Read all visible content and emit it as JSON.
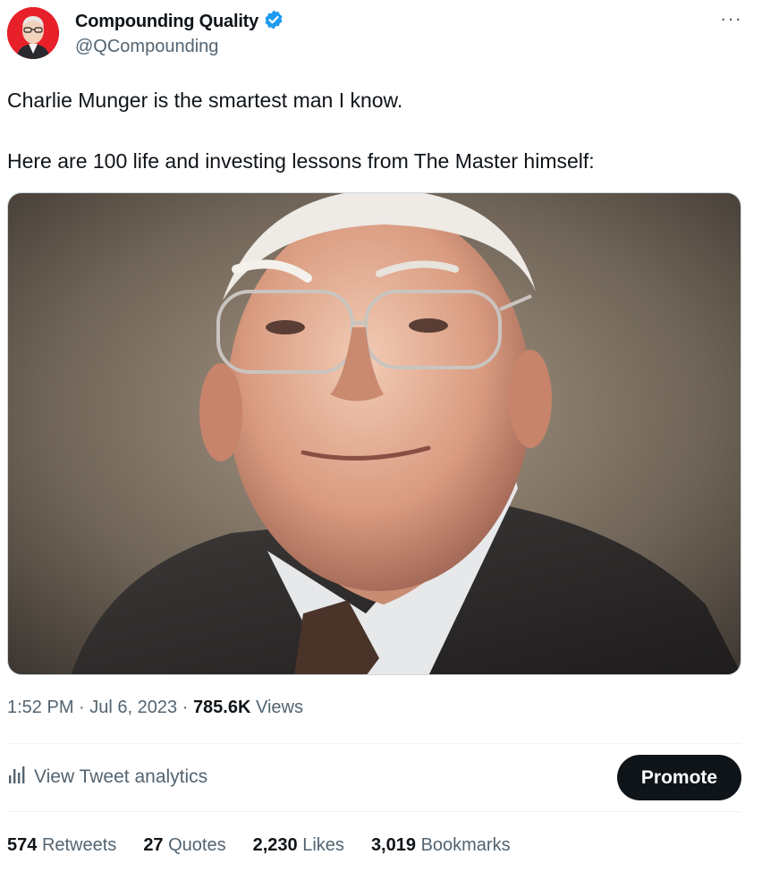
{
  "author": {
    "display_name": "Compounding Quality",
    "handle": "@QCompounding",
    "verified_icon": "verified-badge-icon",
    "avatar_color": "#e8202a"
  },
  "tweet": {
    "lines": [
      "Charlie Munger is the smartest man I know.",
      "Here are 100 life and investing lessons from The Master himself:"
    ],
    "time": "1:52 PM",
    "date": "Jul 6, 2023",
    "views_count": "785.6K",
    "views_label": "Views",
    "separator": "·"
  },
  "actions": {
    "analytics_label": "View Tweet analytics",
    "analytics_icon": "bar-chart-icon",
    "promote_label": "Promote",
    "more_icon": "more-horizontal-icon"
  },
  "stats": [
    {
      "count": "574",
      "label": "Retweets"
    },
    {
      "count": "27",
      "label": "Quotes"
    },
    {
      "count": "2,230",
      "label": "Likes"
    },
    {
      "count": "3,019",
      "label": "Bookmarks"
    }
  ],
  "colors": {
    "text_primary": "#0f1419",
    "text_secondary": "#536471",
    "verified_blue": "#1d9bf0",
    "button_dark": "#0f1419"
  }
}
